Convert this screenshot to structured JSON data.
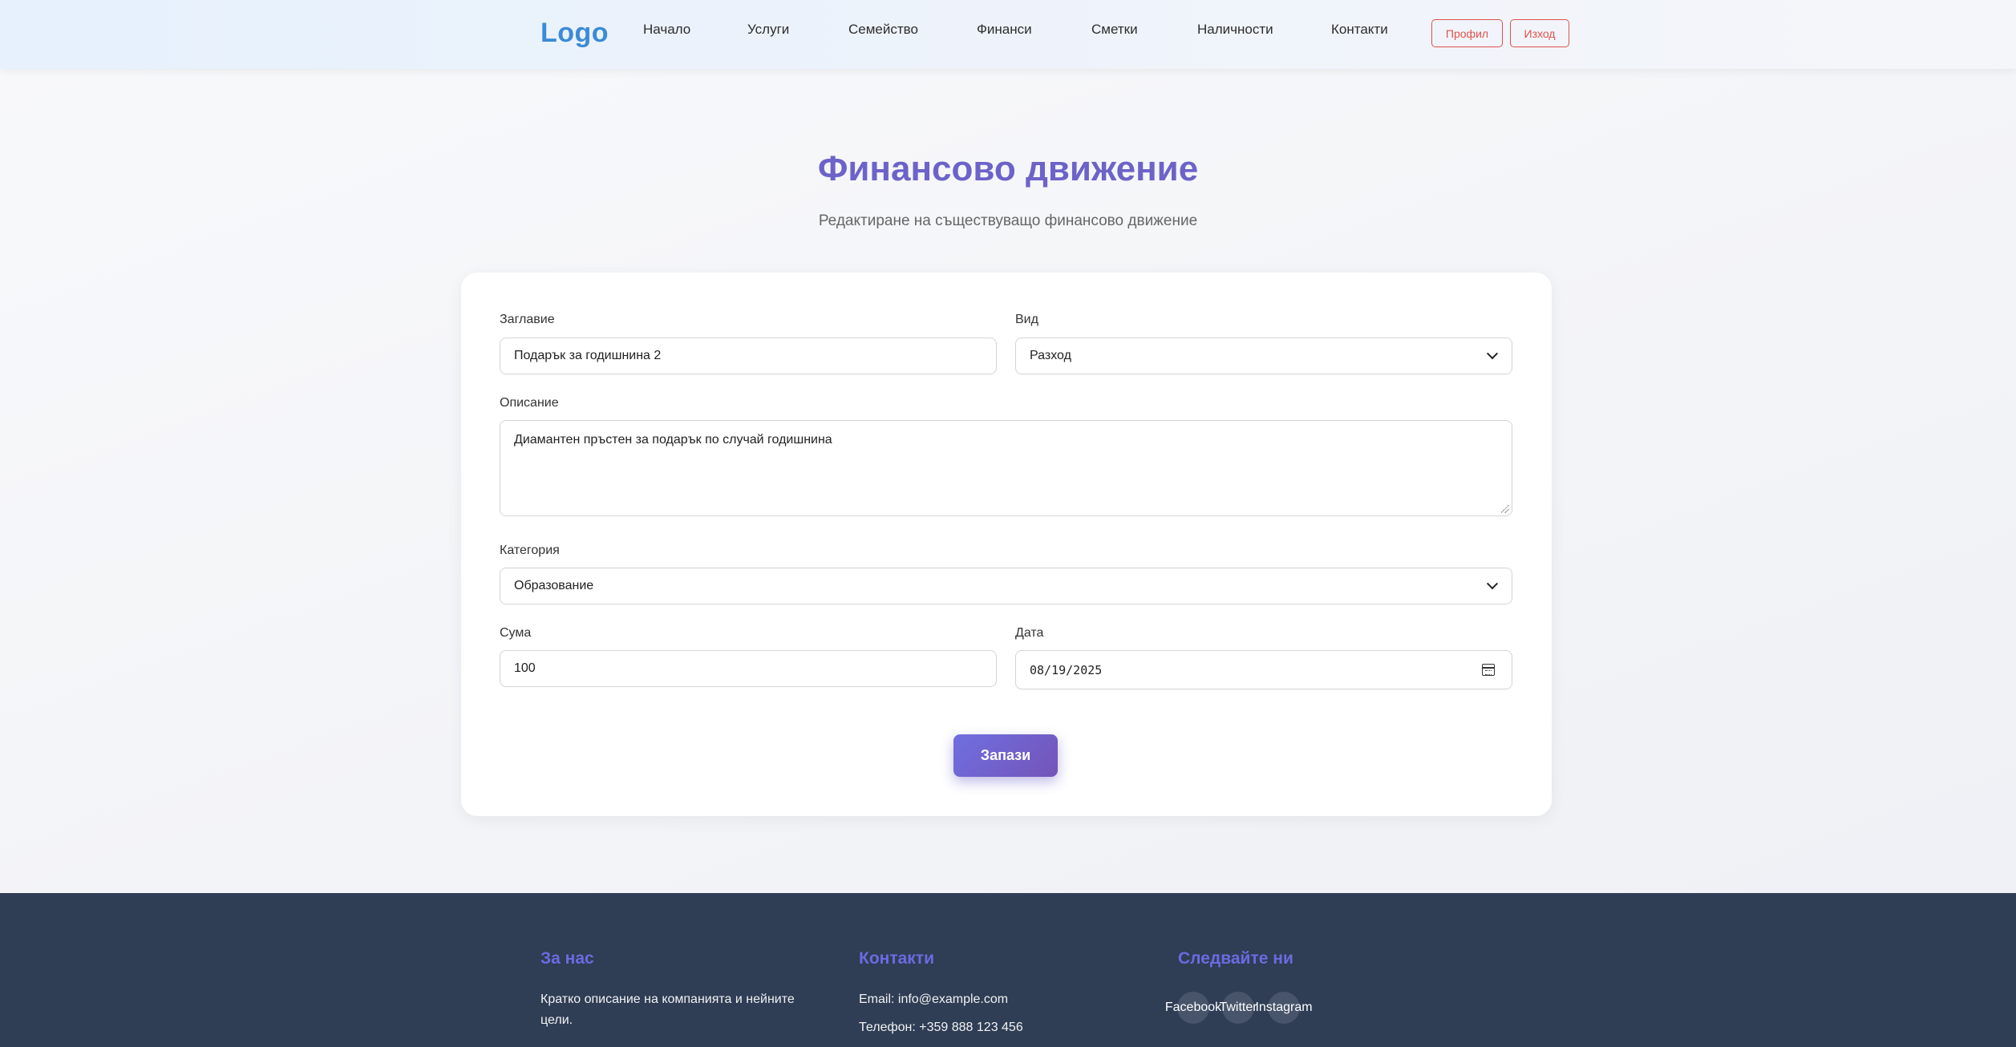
{
  "header": {
    "logo": "Logo",
    "nav": [
      "Начало",
      "Услуги",
      "Семейство",
      "Финанси",
      "Сметки",
      "Наличности",
      "Контакти"
    ],
    "profile_button": "Профил",
    "logout_button": "Изход"
  },
  "page": {
    "title": "Финансово движение",
    "subtitle": "Редактиране на съществуващо финансово движение"
  },
  "form": {
    "title_label": "Заглавие",
    "title_value": "Подарък за годишнина 2",
    "type_label": "Вид",
    "type_value": "Разход",
    "description_label": "Описание",
    "description_value": "Диамантен пръстен за подарък по случай годишнина",
    "category_label": "Категория",
    "category_value": "Образование",
    "amount_label": "Сума",
    "amount_value": "100",
    "date_label": "Дата",
    "date_value": "08/19/2025",
    "submit_label": "Запази"
  },
  "footer": {
    "about_title": "За нас",
    "about_text": "Кратко описание на компанията и нейните цели.",
    "contacts_title": "Контакти",
    "email": "Email: info@example.com",
    "phone": "Телефон: +359 888 123 456",
    "follow_title": "Следвайте ни",
    "social": [
      "Facebook",
      "Twitter",
      "Instagram"
    ]
  },
  "colors": {
    "accent": "#6c63c9",
    "logo": "#3b8bd6",
    "danger": "#e0524b",
    "footer_bg": "#2f3d55"
  }
}
